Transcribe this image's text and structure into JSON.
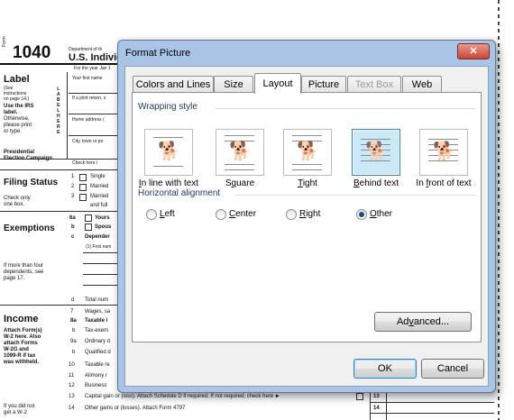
{
  "form": {
    "form_label": "Form",
    "form_number": "1040",
    "dept": "Department of th",
    "title": "U.S. Individ",
    "for_year": "For the year Jan 1",
    "label_heading": "Label",
    "label_instructions": [
      "(See",
      "instructions",
      "on page 14.)"
    ],
    "label_irs": [
      "Use the IRS",
      "label."
    ],
    "label_otherwise": [
      "Otherwise,",
      "please print",
      "or type."
    ],
    "label_vertical": [
      "L",
      "A",
      "B",
      "E",
      "L",
      "",
      "H",
      "E",
      "R",
      "E"
    ],
    "your_first_name": "Your first name",
    "joint_return": "If a joint return, s",
    "home_address": "Home address (",
    "city": "City, town or po",
    "presidential": [
      "Presidential",
      "Election Campaign"
    ],
    "check_here": "Check here i",
    "filing_status": "Filing Status",
    "filing_check": [
      "Check only",
      "one box."
    ],
    "filing_items": [
      {
        "num": "1",
        "text": "Single"
      },
      {
        "num": "2",
        "text": "Married"
      },
      {
        "num": "3",
        "text": "Married"
      }
    ],
    "filing_extra": "and full",
    "exemptions": "Exemptions",
    "exempt_items": [
      {
        "num": "6a",
        "text": "Yours"
      },
      {
        "num": "b",
        "text": "Spous"
      },
      {
        "num": "c",
        "text": "Depender"
      }
    ],
    "first_name_sub": "(1) First nam",
    "more_than_four": [
      "If more than four",
      "dependents, see",
      "page 17."
    ],
    "total_line": {
      "num": "d",
      "text": "Total num"
    },
    "income": "Income",
    "attach": [
      "Attach Form(s)",
      "W-2 here. Also",
      "attach Forms",
      "W-2G and",
      "1099-R if tax",
      "was withheld."
    ],
    "did_not": [
      "If you did not",
      "get a W-2"
    ],
    "income_lines": [
      {
        "num": "7",
        "text": "Wages, sa"
      },
      {
        "num": "8a",
        "text": "Taxable i"
      },
      {
        "num": "b",
        "text": "Tax-exem"
      },
      {
        "num": "9a",
        "text": "Ordinary d"
      },
      {
        "num": "b",
        "text": "Qualified d"
      },
      {
        "num": "10",
        "text": "Taxable re"
      },
      {
        "num": "11",
        "text": "Alimony r"
      },
      {
        "num": "12",
        "text": "Business"
      }
    ],
    "line13": {
      "num": "13",
      "text": "Capital gain or (loss). Attach Schedule D if required. If not required, check here ►",
      "box": "13"
    },
    "line14": {
      "num": "14",
      "text": "Other gains or (losses). Attach Form 4797",
      "box": "14"
    }
  },
  "dialog": {
    "title": "Format Picture",
    "close_glyph": "✕",
    "tabs": [
      {
        "label": "Colors and Lines",
        "state": "normal"
      },
      {
        "label": "Size",
        "state": "normal"
      },
      {
        "label": "Layout",
        "state": "active"
      },
      {
        "label": "Picture",
        "state": "normal"
      },
      {
        "label": "Text Box",
        "state": "disabled"
      },
      {
        "label": "Web",
        "state": "normal"
      }
    ],
    "wrapping_style_label": "Wrapping style",
    "wrap_options": [
      {
        "icon": "dog-in-line-icon",
        "label_pre": "",
        "label_key": "I",
        "label_post": "n line with text",
        "selected": false
      },
      {
        "icon": "dog-square-icon",
        "label_pre": "S",
        "label_key": "q",
        "label_post": "uare",
        "selected": false
      },
      {
        "icon": "dog-tight-icon",
        "label_pre": "",
        "label_key": "T",
        "label_post": "ight",
        "selected": false
      },
      {
        "icon": "dog-behind-text-icon",
        "label_pre": "",
        "label_key": "B",
        "label_post": "ehind text",
        "selected": true
      },
      {
        "icon": "dog-in-front-icon",
        "label_pre": "In ",
        "label_key": "f",
        "label_post": "ront of text",
        "selected": false
      }
    ],
    "horizontal_alignment_label": "Horizontal alignment",
    "alignment_options": [
      {
        "label_pre": "",
        "label_key": "L",
        "label_post": "eft",
        "checked": false
      },
      {
        "label_pre": "",
        "label_key": "C",
        "label_post": "enter",
        "checked": false
      },
      {
        "label_pre": "",
        "label_key": "R",
        "label_post": "ight",
        "checked": false
      },
      {
        "label_pre": "",
        "label_key": "O",
        "label_post": "ther",
        "checked": true
      }
    ],
    "advanced_pre": "Ad",
    "advanced_key": "v",
    "advanced_post": "anced...",
    "ok_label": "OK",
    "cancel_label": "Cancel",
    "colors": {
      "selected_bg": "#cbe8f6",
      "selected_border": "#3c7fb1",
      "title_bar": "#a9c4e4",
      "close_red": "#c8453a"
    }
  }
}
